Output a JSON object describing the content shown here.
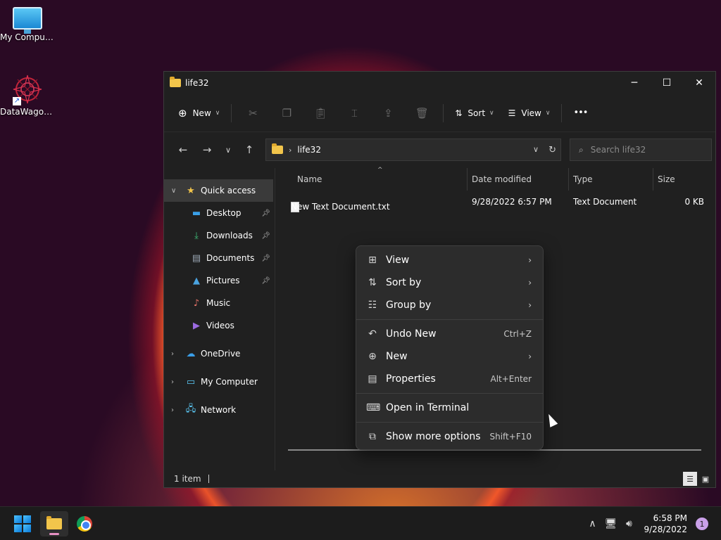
{
  "desktop": {
    "icons": [
      {
        "label": "My Computer",
        "icon": "monitor-icon"
      },
      {
        "label": "DataWagon...",
        "icon": "datawagon-logo"
      }
    ]
  },
  "window": {
    "title": "life32",
    "controls": {
      "minimize": "─",
      "maximize": "☐",
      "close": "✕"
    },
    "command_bar": {
      "new_label": "New",
      "sort_label": "Sort",
      "view_label": "View",
      "more_label": "•••",
      "icons": [
        "cut-icon",
        "copy-icon",
        "paste-icon",
        "rename-icon",
        "share-icon",
        "delete-icon"
      ]
    },
    "address": {
      "folder": "life32",
      "separator": "›",
      "search_placeholder": "Search life32"
    },
    "navigation": {
      "quick_access": "Quick access",
      "quick_items": [
        {
          "label": "Desktop",
          "pinned": true
        },
        {
          "label": "Downloads",
          "pinned": true
        },
        {
          "label": "Documents",
          "pinned": true
        },
        {
          "label": "Pictures",
          "pinned": true
        },
        {
          "label": "Music",
          "pinned": false
        },
        {
          "label": "Videos",
          "pinned": false
        }
      ],
      "onedrive": "OneDrive",
      "my_computer": "My Computer",
      "network": "Network"
    },
    "columns": {
      "name": "Name",
      "date": "Date modified",
      "type": "Type",
      "size": "Size"
    },
    "files": [
      {
        "name": "New Text Document.txt",
        "date": "9/28/2022 6:57 PM",
        "type": "Text Document",
        "size": "0 KB"
      }
    ],
    "status": {
      "count": "1 item"
    }
  },
  "context_menu": {
    "items": [
      {
        "label": "View",
        "icon": "grid-icon",
        "submenu": true
      },
      {
        "label": "Sort by",
        "icon": "sort-icon",
        "submenu": true
      },
      {
        "label": "Group by",
        "icon": "group-icon",
        "submenu": true
      },
      {
        "label": "Undo New",
        "icon": "undo-icon",
        "shortcut": "Ctrl+Z"
      },
      {
        "label": "New",
        "icon": "plus-circle-icon",
        "submenu": true
      },
      {
        "label": "Properties",
        "icon": "properties-icon",
        "shortcut": "Alt+Enter"
      },
      {
        "label": "Open in Terminal",
        "icon": "terminal-icon"
      },
      {
        "label": "Show more options",
        "icon": "more-options-icon",
        "shortcut": "Shift+F10"
      }
    ]
  },
  "taskbar": {
    "clock_time": "6:58 PM",
    "clock_date": "9/28/2022",
    "notification_count": "1",
    "accent": "#0a78d6"
  }
}
